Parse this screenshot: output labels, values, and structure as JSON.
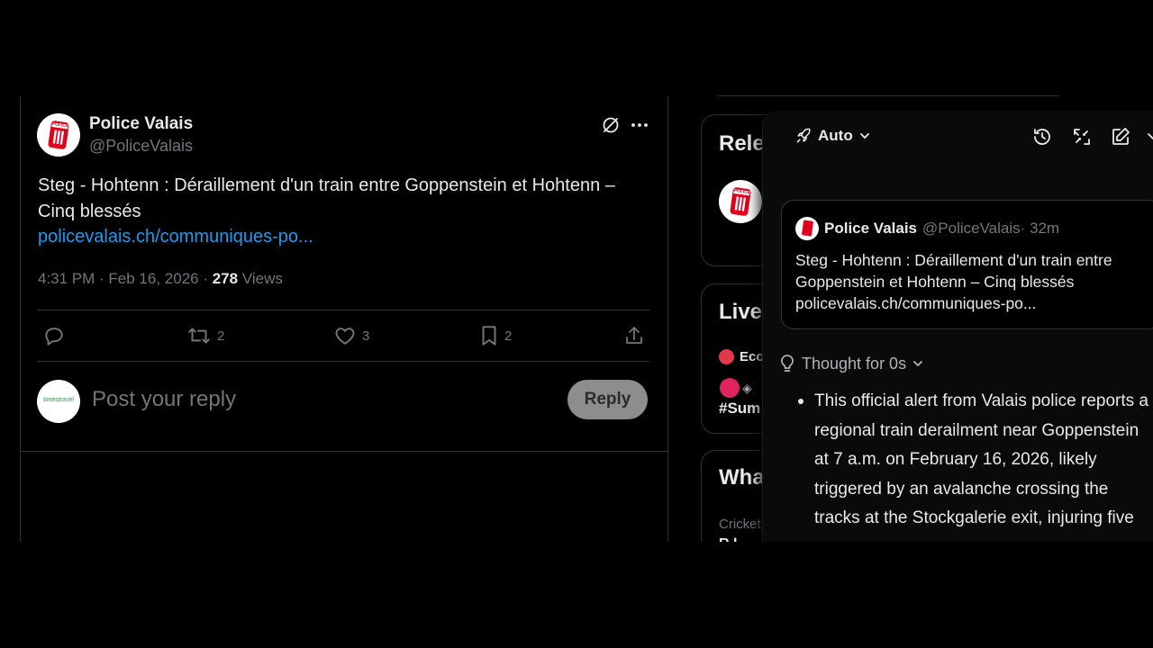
{
  "tweet": {
    "author_name": "Police Valais",
    "author_handle": "@PoliceValais",
    "text_line1": "Steg - Hohtenn : Déraillement d'un train entre Goppenstein et Hohtenn –",
    "text_line2": "Cinq blessés",
    "link": "policevalais.ch/communiques-po...",
    "time": "4:31 PM · Feb 16, 2026 · ",
    "views_count": "278",
    "views_label": " Views",
    "actions": {
      "retweets": "2",
      "likes": "3",
      "bookmarks": "2"
    },
    "logo_text": "POLICE"
  },
  "reply_box": {
    "avatar_text": "timestravel",
    "placeholder": "Post your reply",
    "button_label": "Reply"
  },
  "sidebar": {
    "relevant_title": "Rele",
    "live_title": "Live",
    "live_item1": "Eco",
    "live_item2_tag": "#Sum",
    "whats_title": "Wha",
    "trend_category": "Cricket",
    "trend_partial": "R.l"
  },
  "grok": {
    "mode_label": "Auto",
    "quote": {
      "name": "Police Valais",
      "handle": "@PoliceValais",
      "dot_time": " · 32m",
      "line1": "Steg - Hohtenn : Déraillement d'un train entre",
      "line2": "Goppenstein et Hohtenn – Cinq blessés",
      "link": "policevalais.ch/communiques-po..."
    },
    "thought_label": "Thought for 0s",
    "answer_lines": [
      "This official alert from Valais police reports a",
      "regional train derailment near Goppenstein",
      "at 7 a.m. on February 16, 2026, likely",
      "triggered by an avalanche crossing the",
      "tracks at the Stockgalerie exit, injuring five"
    ]
  },
  "colors": {
    "link": "#1d9bf0",
    "brand_red": "#e2001a",
    "border": "#2f3336"
  }
}
